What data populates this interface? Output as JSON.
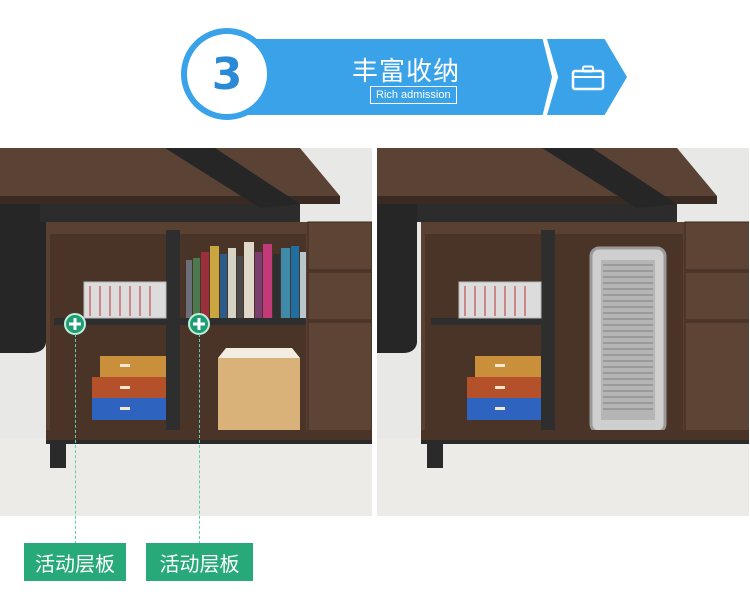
{
  "header": {
    "step_number": "3",
    "title": "丰富收纳",
    "subtitle": "Rich admission",
    "icon": "briefcase-icon"
  },
  "labels": {
    "left_shelf": "活动层板",
    "right_shelf": "活动层板"
  },
  "colors": {
    "accent_blue": "#3aa2e8",
    "label_green": "#27a979",
    "marker_green": "#2fcf9a"
  }
}
